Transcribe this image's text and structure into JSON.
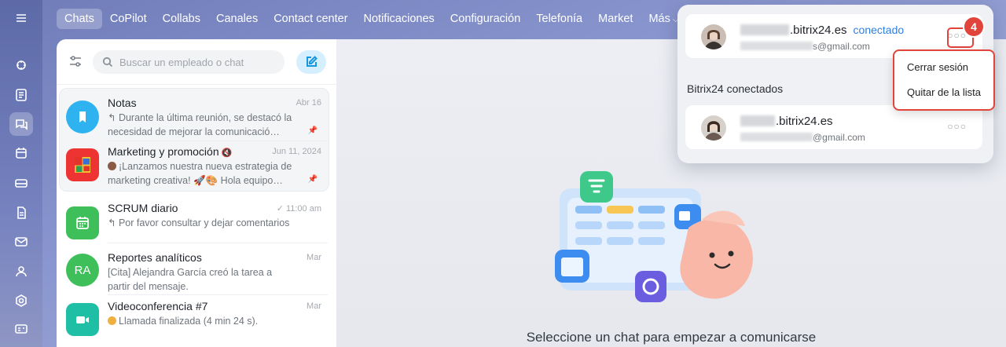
{
  "nav": {
    "tabs": [
      {
        "label": "Chats"
      },
      {
        "label": "CoPilot"
      },
      {
        "label": "Collabs"
      },
      {
        "label": "Canales"
      },
      {
        "label": "Contact center"
      },
      {
        "label": "Notificaciones"
      },
      {
        "label": "Configuración"
      },
      {
        "label": "Telefonía"
      },
      {
        "label": "Market"
      },
      {
        "label": "Más"
      }
    ]
  },
  "search": {
    "placeholder": "Buscar un empleado o chat"
  },
  "chats": [
    {
      "title": "Notas",
      "date": "Abr 16",
      "msg": "↰ Durante la última reunión, se destacó la necesidad de mejorar la comunicació…",
      "avatar_color": "#2fb3f0",
      "icon": "bookmark-icon"
    },
    {
      "title": "Marketing y promoción",
      "date": "Jun 11, 2024",
      "msg": "¡Lanzamos nuestra nueva estrategia de marketing creativa! 🚀🎨 Hola equipo…"
    },
    {
      "title": "SCRUM diario",
      "date": "11:00 am",
      "msg": "↰ Por favor consultar y dejar comentarios",
      "avatar_color": "#3fbf5a",
      "icon": "calendar-icon"
    },
    {
      "title": "Reportes analíticos",
      "date": "Mar",
      "msg": "[Cita] Alejandra García creó la tarea a partir del mensaje.",
      "avatar_color": "#3fbf5a",
      "initials": "RA"
    },
    {
      "title": "Videoconferencia #7",
      "date": "Mar",
      "msg": "Llamada finalizada (4 min 24 s).",
      "avatar_color": "#1fbfa6",
      "icon": "video-icon"
    }
  ],
  "main": {
    "empty_text": "Seleccione un chat para empezar a comunicarse"
  },
  "accounts": {
    "current": {
      "domain": ".bitrix24.es",
      "status": "conectado",
      "email": "s@gmail.com"
    },
    "section_label": "Bitrix24 conectados",
    "others": [
      {
        "domain": ".bitrix24.es",
        "email": "@gmail.com"
      }
    ],
    "more": "○○○"
  },
  "menu": {
    "items": [
      "Cerrar sesión",
      "Quitar de la lista"
    ]
  },
  "badge": "4",
  "colors": {
    "accent": "#2f7fe0",
    "highlight": "#e0443b"
  }
}
